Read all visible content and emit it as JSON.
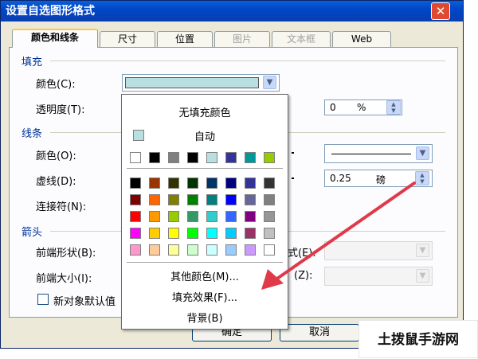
{
  "window": {
    "title": "设置自选图形格式",
    "close_symbol": "✕"
  },
  "tabs": [
    {
      "label": "颜色和线条",
      "active": true,
      "enabled": true
    },
    {
      "label": "尺寸",
      "active": false,
      "enabled": true
    },
    {
      "label": "位置",
      "active": false,
      "enabled": true
    },
    {
      "label": "图片",
      "active": false,
      "enabled": false
    },
    {
      "label": "文本框",
      "active": false,
      "enabled": false
    },
    {
      "label": "Web",
      "active": false,
      "enabled": true
    }
  ],
  "fill": {
    "section": "填充",
    "color_label": "颜色(C):",
    "color_value": "#b9dfe1",
    "transparency_label": "透明度(T):",
    "transparency_value": "0",
    "transparency_unit": "%"
  },
  "line": {
    "section": "线条",
    "color_label": "颜色(O):",
    "dash_label": "虚线(D):",
    "connector_label": "连接符(N):",
    "weight_value": "0.25",
    "weight_unit": "磅"
  },
  "arrows": {
    "section": "箭头",
    "begin_style_label": "前端形状(B):",
    "begin_size_label": "前端大小(I):",
    "end_style_label_tail": "式(E):",
    "end_size_label_tail": "(Z):"
  },
  "new_default_label": "新对象默认值",
  "buttons": {
    "ok": "确定",
    "cancel": "取消"
  },
  "popup": {
    "no_fill": "无填充颜色",
    "auto": "自动",
    "auto_color": "#b9dfe1",
    "recent_colors": [
      "#ffffff",
      "#000000",
      "#808080",
      "#000000",
      "#b9dfe1",
      "#333399",
      "#009999",
      "#99cc00"
    ],
    "palette": [
      [
        "#000000",
        "#993300",
        "#333300",
        "#003300",
        "#003366",
        "#000080",
        "#333399",
        "#333333"
      ],
      [
        "#800000",
        "#ff6600",
        "#808000",
        "#008000",
        "#008080",
        "#0000ff",
        "#666699",
        "#808080"
      ],
      [
        "#ff0000",
        "#ff9900",
        "#99cc00",
        "#339966",
        "#33cccc",
        "#3366ff",
        "#800080",
        "#969696"
      ],
      [
        "#ff00ff",
        "#ffcc00",
        "#ffff00",
        "#00ff00",
        "#00ffff",
        "#00ccff",
        "#993366",
        "#c0c0c0"
      ],
      [
        "#ff99cc",
        "#ffcc99",
        "#ffff99",
        "#ccffcc",
        "#ccffff",
        "#99ccff",
        "#cc99ff",
        "#ffffff"
      ]
    ],
    "more_colors": "其他颜色(M)...",
    "fill_effects": "填充效果(F)...",
    "background": "背景(B)"
  },
  "watermark": "土拨鼠手游网",
  "annotation_arrow_color": "#e03a4a"
}
